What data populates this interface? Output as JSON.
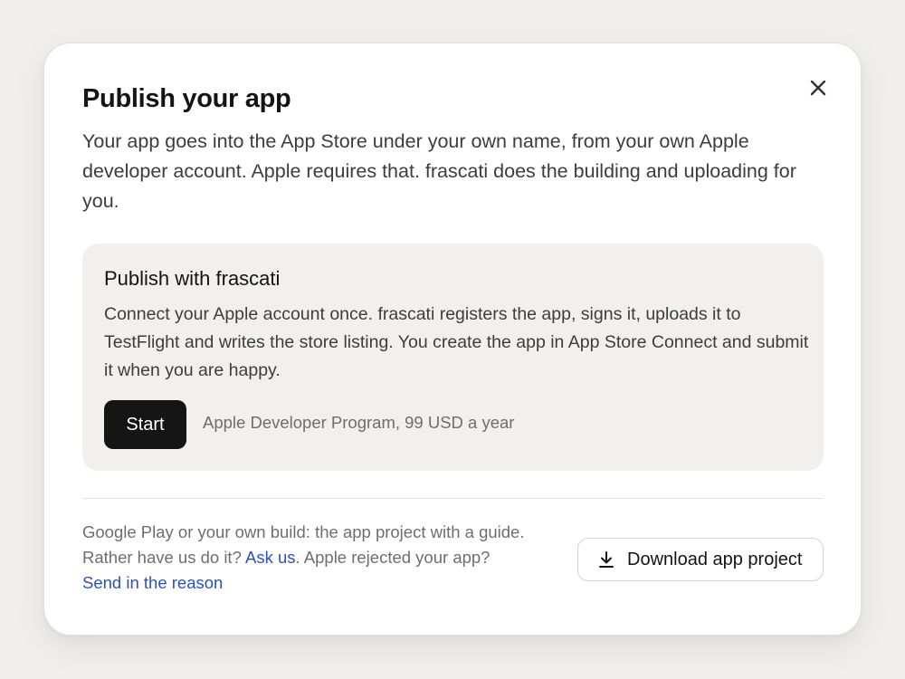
{
  "dialog": {
    "title": "Publish your app",
    "intro": "Your app goes into the App Store under your own name, from your own Apple developer account. Apple requires that. frascati does the building and uploading for you.",
    "close_icon": "close-icon"
  },
  "card": {
    "title": "Publish with frascati",
    "description": "Connect your Apple account once. frascati registers the app, signs it, uploads it to TestFlight and writes the store listing. You create the app in App Store Connect and submit it when you are happy.",
    "start_label": "Start",
    "start_note": "Apple Developer Program, 99 USD a year"
  },
  "footer": {
    "text_1": "Google Play or your own build: the app project with a guide. Rather have us do it? ",
    "link_ask": "Ask us",
    "text_2": ". Apple rejected your app? ",
    "link_reason": "Send in the reason",
    "download_label": "Download app project",
    "download_icon": "download-icon"
  },
  "colors": {
    "background": "#f0efec",
    "card_bg": "#f1f0ec",
    "primary_button": "#151515",
    "link": "#2a52be"
  }
}
